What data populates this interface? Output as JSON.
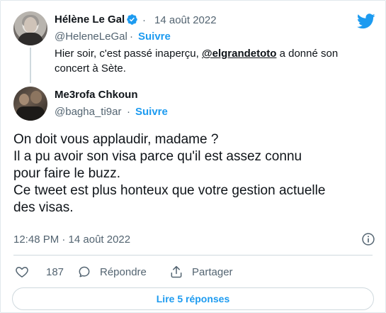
{
  "parent_tweet": {
    "author_name": "Hélène Le Gal",
    "dot": "·",
    "date": "14 août 2022",
    "handle": "@HeleneLeGal",
    "separator": "·",
    "follow_label": "Suivre",
    "text_before": "Hier soir, c'est passé inaperçu, ",
    "mention": "@elgrandetoto",
    "text_after": " a donné son concert à Sète."
  },
  "main_tweet": {
    "author_name": "Me3rofa Chkoun",
    "handle": "@bagha_ti9ar",
    "separator": "·",
    "follow_label": "Suivre",
    "text_lines": [
      "On doit vous applaudir, madame ?",
      "Il a pu avoir son visa parce qu'il est assez connu",
      "pour faire le buzz.",
      "Ce tweet est plus honteux que votre gestion actuelle",
      "des visas."
    ],
    "timestamp": "12:48 PM · 14 août 2022"
  },
  "actions": {
    "like_count": "187",
    "reply_label": "Répondre",
    "share_label": "Partager"
  },
  "replies_button_label": "Lire 5 réponses",
  "colors": {
    "accent": "#1d9bf0",
    "text": "#0f1419",
    "secondary_text": "#536471",
    "border": "#cfd9de"
  },
  "icons": {
    "brand": "twitter-bird-icon",
    "verified": "verified-badge-icon",
    "info": "info-icon",
    "like": "heart-icon",
    "reply": "comment-icon",
    "share": "share-icon"
  }
}
